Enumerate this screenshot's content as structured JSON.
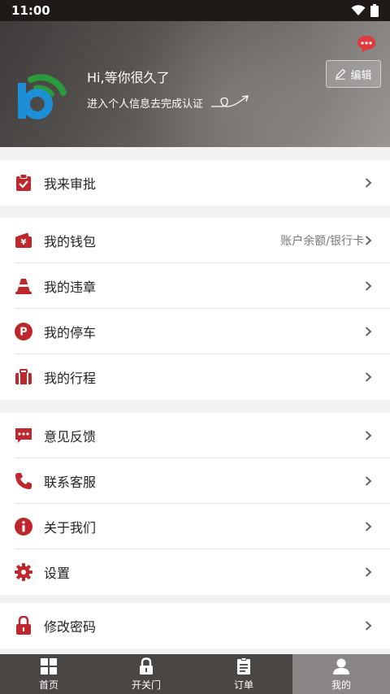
{
  "status_bar": {
    "time": "11:00"
  },
  "header": {
    "greeting": "Hi,等你很久了",
    "subline": "进入个人信息去完成认证",
    "edit_label": "编辑"
  },
  "menu_groups": [
    {
      "items": [
        {
          "label": "我来审批",
          "icon": "clipboard-check-icon"
        }
      ]
    },
    {
      "items": [
        {
          "label": "我的钱包",
          "extra": "账户余额/银行卡",
          "icon": "wallet-icon"
        },
        {
          "label": "我的违章",
          "icon": "traffic-cone-icon"
        },
        {
          "label": "我的停车",
          "icon": "parking-icon"
        },
        {
          "label": "我的行程",
          "icon": "suitcase-icon"
        }
      ]
    },
    {
      "items": [
        {
          "label": "意见反馈",
          "icon": "feedback-icon"
        },
        {
          "label": "联系客服",
          "icon": "phone-icon"
        },
        {
          "label": "关于我们",
          "icon": "info-icon"
        },
        {
          "label": "设置",
          "icon": "gear-icon"
        }
      ]
    },
    {
      "items": [
        {
          "label": "修改密码",
          "icon": "lock-icon"
        }
      ]
    }
  ],
  "tabs": [
    {
      "label": "首页",
      "icon": "grid-icon",
      "active": false
    },
    {
      "label": "开关门",
      "icon": "lock-icon",
      "active": false
    },
    {
      "label": "订单",
      "icon": "document-icon",
      "active": false
    },
    {
      "label": "我的",
      "icon": "person-icon",
      "active": true
    }
  ],
  "colors": {
    "accent": "#c0272d",
    "header_bg": "#5a5654",
    "tabbar_bg": "#4a4644",
    "tab_active_bg": "#8a8685"
  }
}
